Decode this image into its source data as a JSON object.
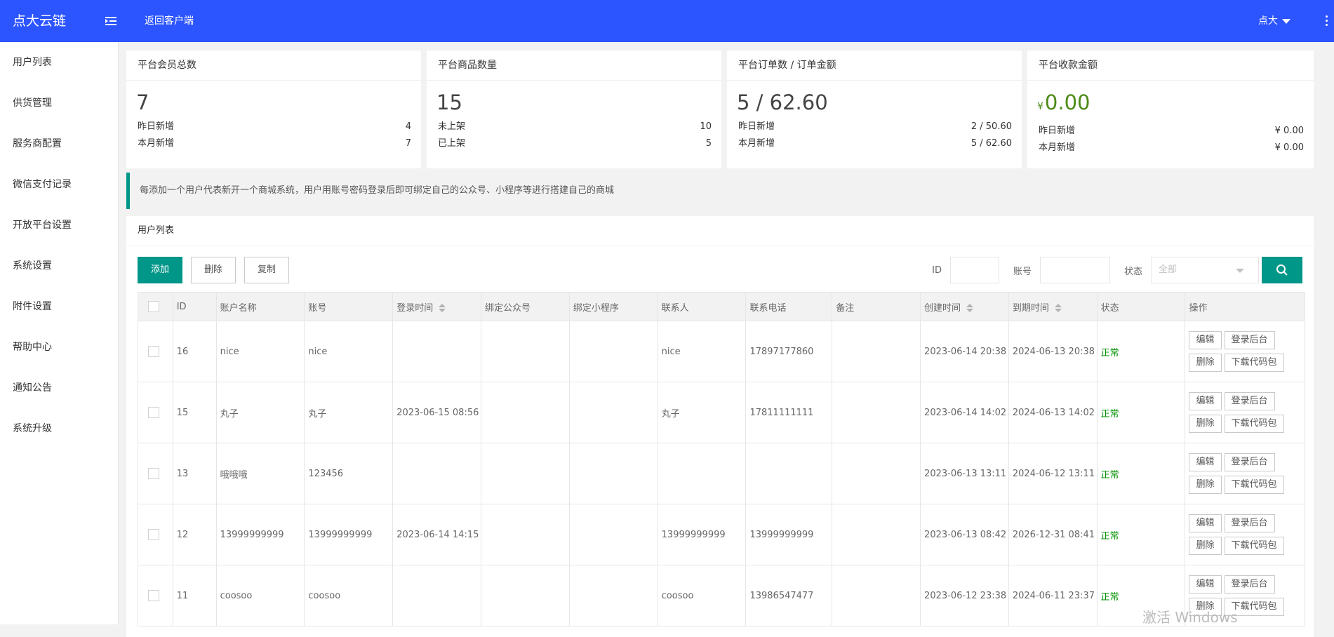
{
  "header": {
    "logo": "点大云链",
    "back_link": "返回客户端",
    "user_name": "点大"
  },
  "sidebar": {
    "items": [
      "用户列表",
      "供货管理",
      "服务商配置",
      "微信支付记录",
      "开放平台设置",
      "系统设置",
      "附件设置",
      "帮助中心",
      "通知公告",
      "系统升级"
    ]
  },
  "cards": [
    {
      "title": "平台会员总数",
      "value": "7",
      "rows": [
        {
          "label": "昨日新增",
          "value": "4"
        },
        {
          "label": "本月新增",
          "value": "7"
        }
      ]
    },
    {
      "title": "平台商品数量",
      "value": "15",
      "rows": [
        {
          "label": "未上架",
          "value": "10"
        },
        {
          "label": "已上架",
          "value": "5"
        }
      ]
    },
    {
      "title": "平台订单数 / 订单金额",
      "value": "5 / 62.60",
      "rows": [
        {
          "label": "昨日新增",
          "value": "2 / 50.60"
        },
        {
          "label": "本月新增",
          "value": "5 / 62.60"
        }
      ]
    },
    {
      "title": "平台收款金额",
      "currency": "¥",
      "value": "0.00",
      "rows": [
        {
          "label": "昨日新增",
          "value": "¥ 0.00"
        },
        {
          "label": "本月新增",
          "value": "¥ 0.00"
        }
      ]
    }
  ],
  "notice": "每添加一个用户代表新开一个商城系统，用户用账号密码登录后即可绑定自己的公众号、小程序等进行搭建自己的商城",
  "panel": {
    "title": "用户列表",
    "buttons": {
      "add": "添加",
      "delete": "删除",
      "copy": "复制"
    },
    "filters": {
      "id_label": "ID",
      "account_label": "账号",
      "status_label": "状态",
      "status_value": "全部"
    }
  },
  "table": {
    "columns": [
      "ID",
      "账户名称",
      "账号",
      "登录时间",
      "绑定公众号",
      "绑定小程序",
      "联系人",
      "联系电话",
      "备注",
      "创建时间",
      "到期时间",
      "状态",
      "操作"
    ],
    "row_buttons": {
      "edit": "编辑",
      "login": "登录后台",
      "delete": "删除",
      "download": "下载代码包"
    },
    "rows": [
      {
        "id": "16",
        "name": "nice",
        "account": "nice",
        "login_time": "",
        "gzh": "",
        "xcx": "",
        "contact": "nice",
        "phone": "17897177860",
        "remark": "",
        "created": "2023-06-14 20:38",
        "expires": "2024-06-13 20:38",
        "status": "正常"
      },
      {
        "id": "15",
        "name": "丸子",
        "account": "丸子",
        "login_time": "2023-06-15 08:56",
        "gzh": "",
        "xcx": "",
        "contact": "丸子",
        "phone": "17811111111",
        "remark": "",
        "created": "2023-06-14 14:02",
        "expires": "2024-06-13 14:02",
        "status": "正常"
      },
      {
        "id": "13",
        "name": "哦哦哦",
        "account": "123456",
        "login_time": "",
        "gzh": "",
        "xcx": "",
        "contact": "",
        "phone": "",
        "remark": "",
        "created": "2023-06-13 13:11",
        "expires": "2024-06-12 13:11",
        "status": "正常"
      },
      {
        "id": "12",
        "name": "13999999999",
        "account": "13999999999",
        "login_time": "2023-06-14 14:15",
        "gzh": "",
        "xcx": "",
        "contact": "13999999999",
        "phone": "13999999999",
        "remark": "",
        "created": "2023-06-13 08:42",
        "expires": "2026-12-31 08:41",
        "status": "正常"
      },
      {
        "id": "11",
        "name": "coosoo",
        "account": "coosoo",
        "login_time": "",
        "gzh": "",
        "xcx": "",
        "contact": "coosoo",
        "phone": "13986547477",
        "remark": "",
        "created": "2023-06-12 23:38",
        "expires": "2024-06-11 23:37",
        "status": "正常"
      }
    ]
  },
  "watermark": "激活 Windows",
  "colors": {
    "topbar": "#2c54ff",
    "primary": "#009688",
    "status_ok": "#009100",
    "revenue": "#4d8a16"
  }
}
